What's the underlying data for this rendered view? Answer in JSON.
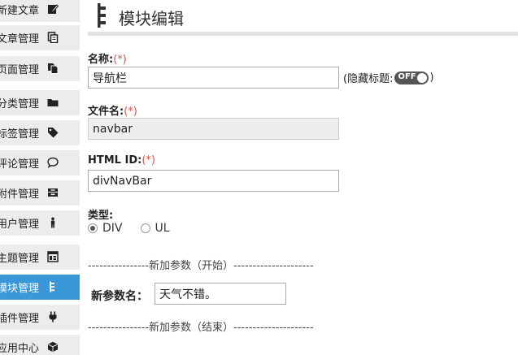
{
  "sidebar": {
    "items": [
      {
        "label": "新建文章",
        "icon": "edit-icon",
        "active": false
      },
      {
        "label": "文章管理",
        "icon": "copy-icon",
        "active": false
      },
      {
        "label": "页面管理",
        "icon": "files-icon",
        "active": false
      },
      {
        "label": "分类管理",
        "icon": "folder-icon",
        "active": false
      },
      {
        "label": "标签管理",
        "icon": "tag-icon",
        "active": false
      },
      {
        "label": "评论管理",
        "icon": "comment-icon",
        "active": false
      },
      {
        "label": "附件管理",
        "icon": "inbox-icon",
        "active": false
      },
      {
        "label": "用户管理",
        "icon": "person-icon",
        "active": false
      },
      {
        "label": "主题管理",
        "icon": "layout-icon",
        "active": false
      },
      {
        "label": "模块管理",
        "icon": "tree-icon",
        "active": true
      },
      {
        "label": "插件管理",
        "icon": "plug-icon",
        "active": false
      },
      {
        "label": "应用中心",
        "icon": "box-icon",
        "active": false
      }
    ]
  },
  "header": {
    "title": "模块编辑"
  },
  "form": {
    "name_label": "名称:",
    "name_required": "(*)",
    "name_value": "导航栏",
    "hide_title_prefix": "(隐藏标题:",
    "hide_title_suffix": ")",
    "toggle_state": "OFF",
    "filename_label": "文件名:",
    "filename_required": "(*)",
    "filename_value": "navbar",
    "htmlid_label": "HTML ID:",
    "htmlid_required": "(*)",
    "htmlid_value": "divNavBar",
    "type_label": "类型:",
    "type_options": [
      "DIV",
      "UL"
    ],
    "type_selected": "DIV",
    "param_start_divider": "----------------新加参数（开始）---------------------",
    "new_param_label": "新参数名：",
    "new_param_value": "天气不错。",
    "param_end_divider": "----------------新加参数（结束）---------------------"
  },
  "colors": {
    "active_bg": "#3a98d8",
    "sidebar_bg": "#ececec",
    "required": "#d9534f"
  }
}
